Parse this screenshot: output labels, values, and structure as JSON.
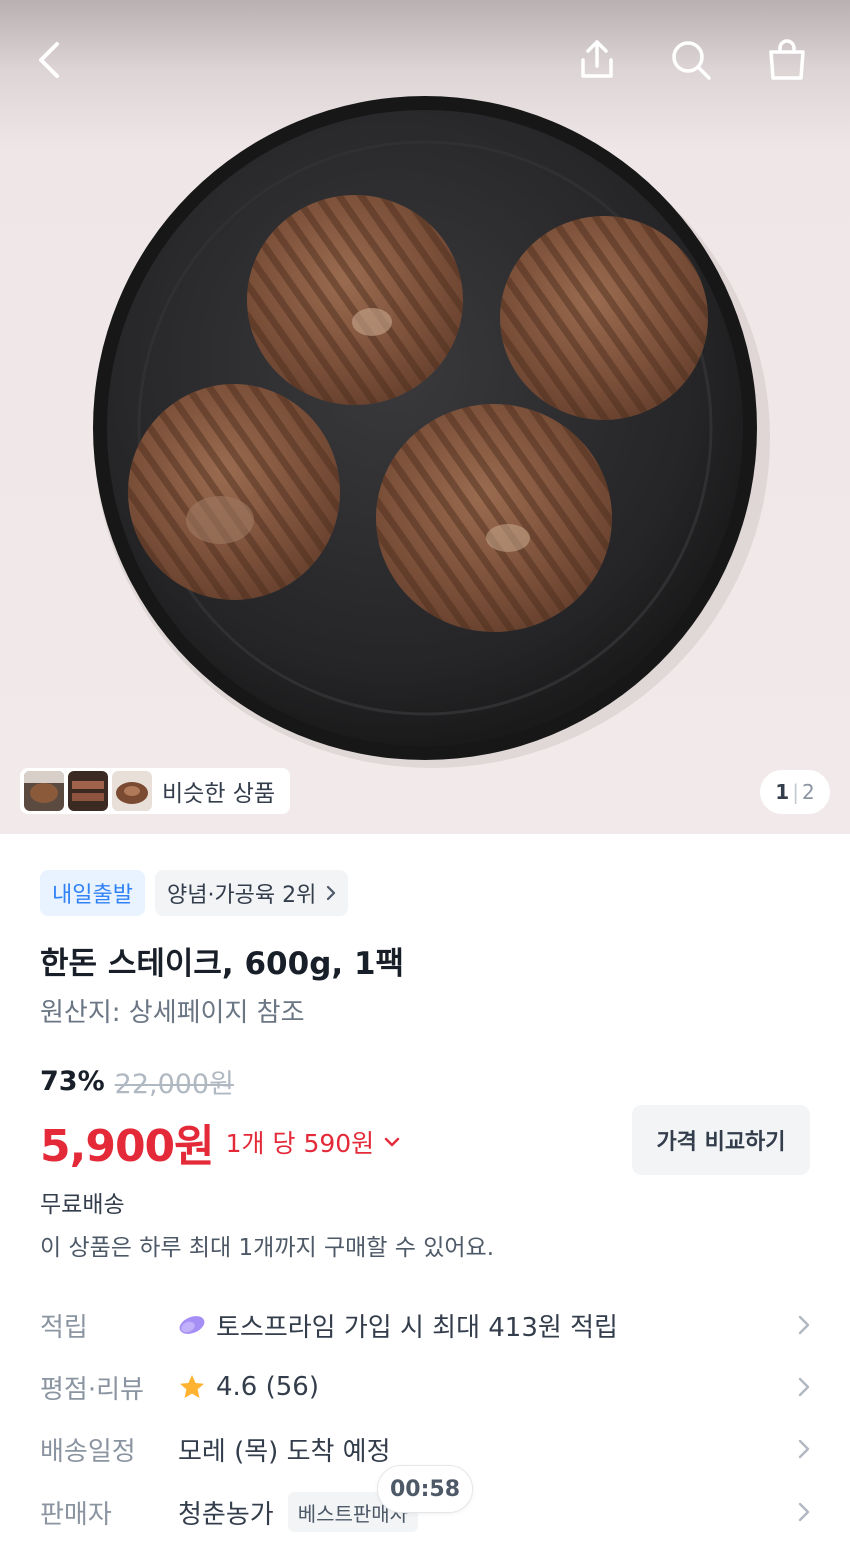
{
  "header": {
    "back_icon": "chevron-left-icon",
    "share_icon": "share-icon",
    "search_icon": "search-icon",
    "cart_icon": "shopping-bag-icon"
  },
  "gallery": {
    "similar_label": "비슷한 상품",
    "current_page": "1",
    "separator": "|",
    "total_pages": "2"
  },
  "badges": {
    "delivery": "내일출발",
    "ranking": "양념·가공육 2위"
  },
  "product": {
    "title": "한돈 스테이크, 600g, 1팩",
    "origin": "원산지: 상세페이지 참조"
  },
  "pricing": {
    "discount_rate": "73%",
    "original_price": "22,000원",
    "sale_price": "5,900원",
    "unit_price": "1개 당 590원",
    "compare_button": "가격 비교하기",
    "shipping": "무료배송",
    "purchase_limit": "이 상품은 하루 최대 1개까지 구매할 수 있어요."
  },
  "info_rows": {
    "points": {
      "label": "적립",
      "value": "토스프라임 가입 시 최대 413원 적립"
    },
    "rating": {
      "label": "평점·리뷰",
      "value": "4.6 (56)"
    },
    "delivery": {
      "label": "배송일정",
      "value": "모레 (목) 도착 예정"
    },
    "seller": {
      "label": "판매자",
      "value": "청춘농가",
      "badge": "베스트판매자"
    }
  },
  "timer": "00:58",
  "colors": {
    "sale_red": "#e42939",
    "badge_blue": "#3182f6",
    "badge_blue_bg": "#e8f3ff",
    "star": "#ffb331",
    "prime_purple": "#a58ff5"
  }
}
